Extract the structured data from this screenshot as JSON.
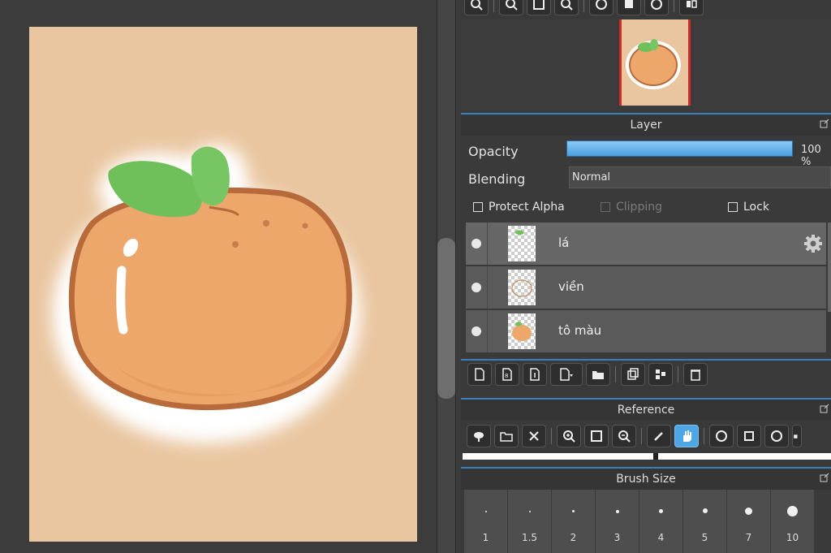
{
  "layer_panel": {
    "title": "Layer",
    "opacity_label": "Opacity",
    "opacity_value": "100 %",
    "opacity_level": 1.0,
    "blending_label": "Blending",
    "blending_value": "Normal",
    "protect_alpha": "Protect Alpha",
    "clipping": "Clipping",
    "lock": "Lock",
    "layers": [
      {
        "name": "lá",
        "selected": true
      },
      {
        "name": "viền",
        "selected": false
      },
      {
        "name": "tô màu",
        "selected": false
      }
    ]
  },
  "reference_panel": {
    "title": "Reference"
  },
  "brush_panel": {
    "title": "Brush Size",
    "sizes": [
      "1",
      "1.5",
      "2",
      "3",
      "4",
      "5",
      "7",
      "10"
    ]
  },
  "colors": {
    "paper": "#e9c6a0",
    "orange": "#eea76b",
    "outline": "#b86a3a",
    "leaf": "#6fbf5a",
    "accent": "#4ea6e6",
    "frame": "#d12c2c"
  },
  "icons": {
    "navigator_toolbar": [
      "zoom-fit-icon",
      "zoom-in-icon",
      "fit-icon",
      "zoom-out-icon",
      "rotate-left-icon",
      "reset-icon",
      "rotate-right-icon",
      "flip-icon"
    ],
    "layer_toolbar": [
      "new-layer-icon",
      "new-raster-icon",
      "import-icon",
      "add-layer-menu-icon",
      "folder-icon",
      "duplicate-icon",
      "merge-icon",
      "delete-icon"
    ],
    "reference_toolbar": [
      "open-cloud-icon",
      "open-folder-icon",
      "close-icon",
      "zoom-in-icon",
      "fit-icon",
      "zoom-out-icon",
      "eyedropper-icon",
      "hand-icon",
      "rotate-left-icon",
      "reset-icon",
      "rotate-right-icon",
      "more-icon"
    ]
  }
}
